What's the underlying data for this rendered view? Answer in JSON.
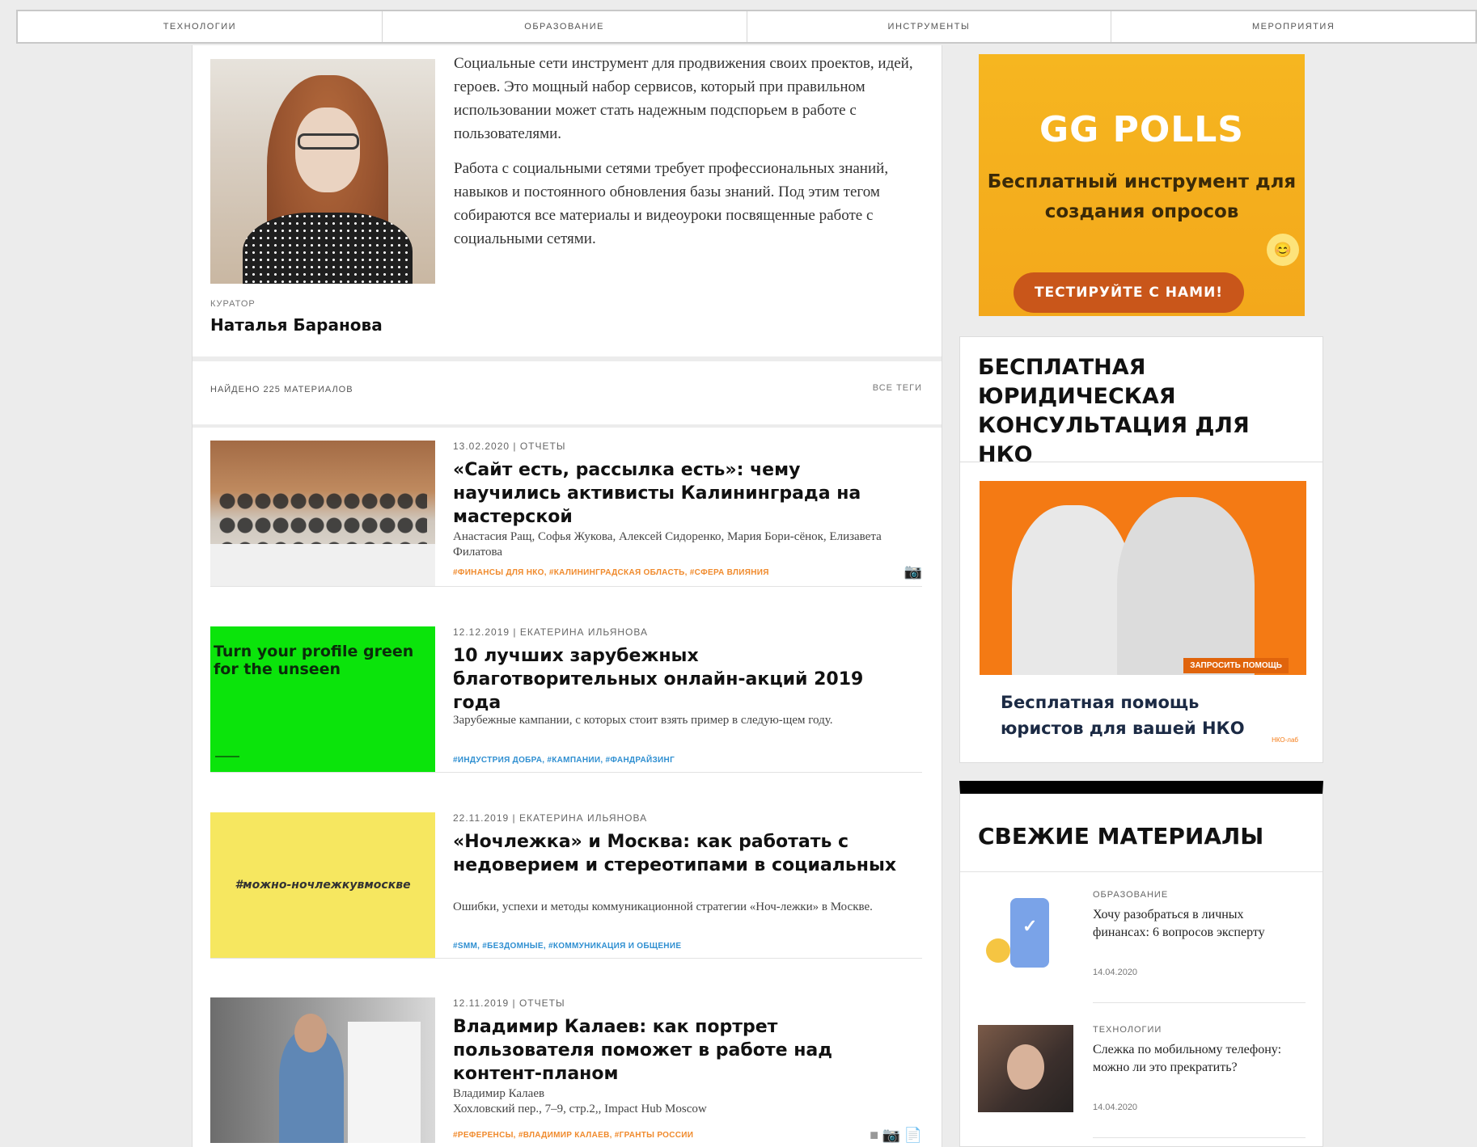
{
  "nav": [
    "ТЕХНОЛОГИИ",
    "ОБРАЗОВАНИЕ",
    "ИНСТРУМЕНТЫ",
    "МЕРОПРИЯТИЯ"
  ],
  "curator": {
    "label": "КУРАТОР",
    "name": "Наталья Баранова",
    "intro_p1": "Социальные сети инструмент для продвижения своих проектов, идей, героев. Это мощный набор сервисов, который при правильном использовании может стать надежным подспорьем в работе с пользователями.",
    "intro_p2": "Работа с социальными сетями требует профессиональных знаний, навыков и постоянного обновления базы знаний. Под этим тегом собираются все материалы и видеоуроки посвященные работе с социальными сетями."
  },
  "listing": {
    "found": "НАЙДЕНО 225 МАТЕРИАЛОВ",
    "all_tags": "ВСЕ ТЕГИ"
  },
  "articles": [
    {
      "meta": "13.02.2020 | ОТЧЕТЫ",
      "title": "«Сайт есть, рассылка есть»: чему научились активисты Калининграда на мастерской",
      "desc": "Анастасия Ращ, Софья Жукова, Алексей Сидоренко, Мария Бори-сёнок, Елизавета Филатова",
      "tags": "#ФИНАНСЫ ДЛЯ НКО, #КАЛИНИНГРАДСКАЯ ОБЛАСТЬ, #СФЕРА ВЛИЯНИЯ",
      "tag_color": "#f08a2c",
      "icon_camera": "📷"
    },
    {
      "meta": "12.12.2019 | ЕКАТЕРИНА ИЛЬЯНОВА",
      "title": "10 лучших зарубежных благотворительных онлайн-акций 2019 года",
      "desc": "Зарубежные кампании, с которых стоит взять пример в следую-щем году.",
      "tags": "#ИНДУСТРИЯ ДОБРА, #КАМПАНИИ, #ФАНДРАЙЗИНГ",
      "tag_color": "#2f8fd1",
      "thumb_text": "Turn your profile green for the unseen"
    },
    {
      "meta": "22.11.2019 | ЕКАТЕРИНА ИЛЬЯНОВА",
      "title": "«Ночлежка» и Москва: как работать с недоверием и стереотипами в социальных",
      "desc": "Ошибки, успехи и методы коммуникационной стратегии «Ноч-лежки» в Москве.",
      "tags": "#SMM, #БЕЗДОМНЫЕ, #КОММУНИКАЦИЯ И ОБЩЕНИЕ",
      "tag_color": "#2f8fd1",
      "thumb_text": "#можно-ночлежкувмоскве"
    },
    {
      "meta": "12.11.2019 | ОТЧЕТЫ",
      "title": "Владимир Калаев: как портрет пользователя поможет в работе над контент-планом",
      "desc": "Владимир Калаев\nХохловский пер., 7–9, стр.2,, Impact Hub Moscow",
      "tags": "#РЕФЕРЕНСЫ, #ВЛАДИМИР КАЛАЕВ, #ГРАНТЫ РОССИИ",
      "tag_color": "#f08a2c",
      "icons": "■ 📷 📄"
    }
  ],
  "ad_polls": {
    "title": "GG POLLS",
    "subtitle": "Бесплатный инструмент для создания опросов",
    "button": "ТЕСТИРУЙТЕ С НАМИ!",
    "emoji": "😊"
  },
  "legal": {
    "heading": "БЕСПЛАТНАЯ ЮРИДИЧЕСКАЯ КОНСУЛЬТАЦИЯ ДЛЯ НКО",
    "request": "ЗАПРОСИТЬ ПОМОЩЬ",
    "caption": "Бесплатная помощь юристов для вашей НКО",
    "mini": "НКО-лаб"
  },
  "fresh": {
    "heading": "СВЕЖИЕ МАТЕРИАЛЫ",
    "items": [
      {
        "category": "ОБРАЗОВАНИЕ",
        "title": "Хочу разобраться в личных финансах: 6 вопросов эксперту",
        "date": "14.04.2020"
      },
      {
        "category": "ТЕХНОЛОГИИ",
        "title": "Слежка по мобильному телефону: можно ли это прекратить?",
        "date": "14.04.2020"
      }
    ]
  },
  "colors": {
    "accent_orange": "#f08a2c",
    "tag_blue": "#2f8fd1",
    "polls_yellow": "#f4b01e",
    "legal_orange": "#f47a14"
  }
}
